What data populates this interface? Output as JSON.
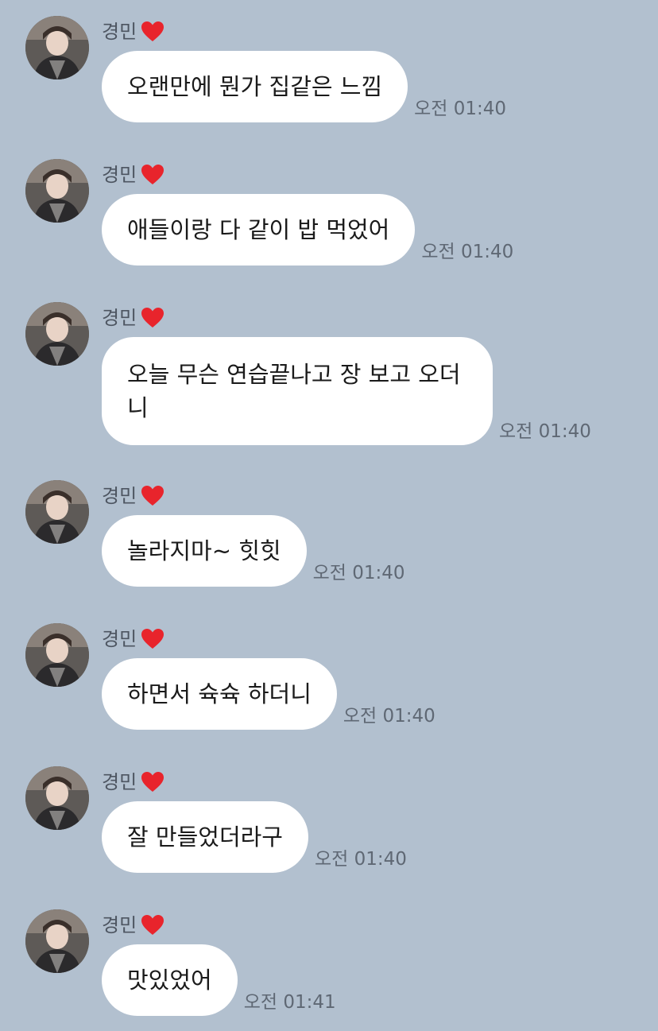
{
  "sender": {
    "name": "경민",
    "emoji_icon": "red-heart-icon",
    "heart_color": "#e8242c"
  },
  "colors": {
    "background": "#b2c0cf",
    "bubble": "#ffffff"
  },
  "messages": [
    {
      "text": "오랜만에 뭔가 집같은 느낌",
      "time": "오전 01:40"
    },
    {
      "text": "애들이랑 다 같이 밥 먹었어",
      "time": "오전 01:40"
    },
    {
      "text": "오늘 무슨 연습끝나고 장 보고 오더니",
      "time": "오전 01:40"
    },
    {
      "text": "놀라지마~ 힛힛",
      "time": "오전 01:40"
    },
    {
      "text": "하면서 슉슉 하더니",
      "time": "오전 01:40"
    },
    {
      "text": "잘 만들었더라구",
      "time": "오전 01:40"
    },
    {
      "text": "맛있었어",
      "time": "오전 01:41"
    }
  ]
}
